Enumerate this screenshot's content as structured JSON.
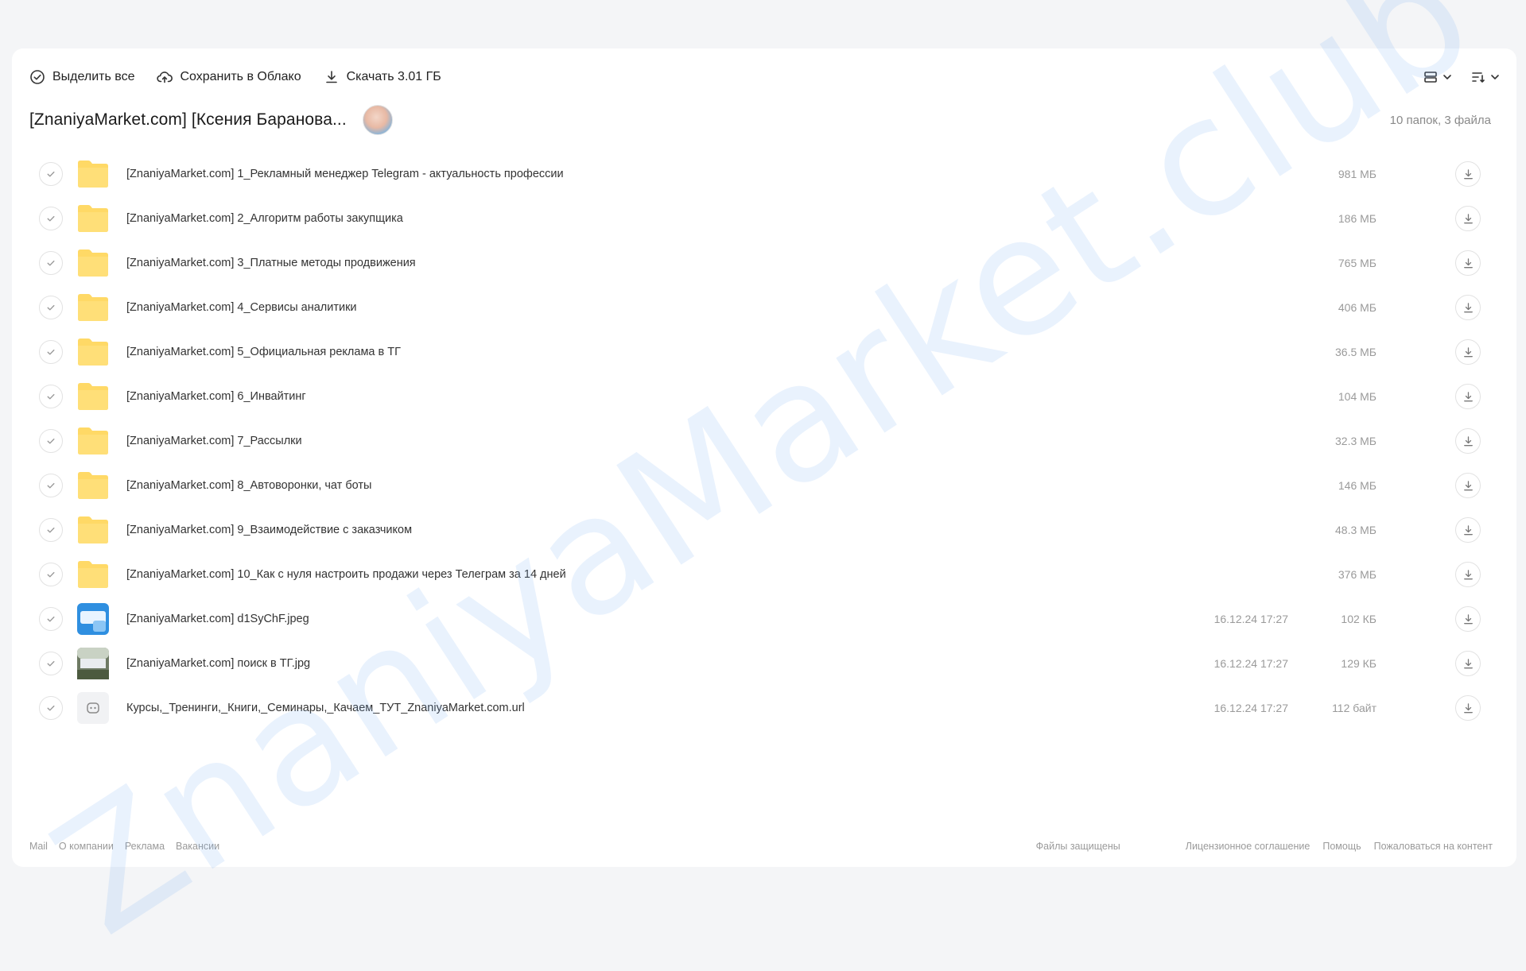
{
  "toolbar": {
    "select_all": "Выделить все",
    "save_cloud": "Сохранить в Облако",
    "download": "Скачать 3.01 ГБ",
    "view_icon": "list-view-icon",
    "sort_icon": "sort-icon"
  },
  "folder": {
    "title": "[ZnaniyaMarket.com] [Ксения Баранова...",
    "summary": "10 папок, 3 файла"
  },
  "items": [
    {
      "name": "[ZnaniyaMarket.com] 1_Рекламный менеджер Telegram - актуальность профессии",
      "date": "",
      "size": "981 МБ",
      "kind": "folder"
    },
    {
      "name": "[ZnaniyaMarket.com] 2_Алгоритм работы закупщика",
      "date": "",
      "size": "186 МБ",
      "kind": "folder"
    },
    {
      "name": "[ZnaniyaMarket.com] 3_Платные методы продвижения",
      "date": "",
      "size": "765 МБ",
      "kind": "folder"
    },
    {
      "name": "[ZnaniyaMarket.com] 4_Сервисы аналитики",
      "date": "",
      "size": "406 МБ",
      "kind": "folder"
    },
    {
      "name": "[ZnaniyaMarket.com] 5_Официальная реклама в ТГ",
      "date": "",
      "size": "36.5 МБ",
      "kind": "folder"
    },
    {
      "name": "[ZnaniyaMarket.com] 6_Инвайтинг",
      "date": "",
      "size": "104 МБ",
      "kind": "folder"
    },
    {
      "name": "[ZnaniyaMarket.com] 7_Рассылки",
      "date": "",
      "size": "32.3 МБ",
      "kind": "folder"
    },
    {
      "name": "[ZnaniyaMarket.com] 8_Автоворонки, чат боты",
      "date": "",
      "size": "146 МБ",
      "kind": "folder"
    },
    {
      "name": "[ZnaniyaMarket.com] 9_Взаимодействие с заказчиком",
      "date": "",
      "size": "48.3 МБ",
      "kind": "folder"
    },
    {
      "name": "[ZnaniyaMarket.com] 10_Как с нуля настроить продажи через Телеграм за 14 дней",
      "date": "",
      "size": "376 МБ",
      "kind": "folder"
    },
    {
      "name": "[ZnaniyaMarket.com] d1SyChF.jpeg",
      "date": "16.12.24 17:27",
      "size": "102 КБ",
      "kind": "image-blue"
    },
    {
      "name": "[ZnaniyaMarket.com] поиск в ТГ.jpg",
      "date": "16.12.24 17:27",
      "size": "129 КБ",
      "kind": "image-photo"
    },
    {
      "name": "Курсы,_Тренинги,_Книги,_Семинары,_Качаем_ТУТ_ZnaniyaMarket.com.url",
      "date": "16.12.24 17:27",
      "size": "112 байт",
      "kind": "url"
    }
  ],
  "watermark": "ZnaniyaMarket.club",
  "footer": {
    "left": [
      "Mail",
      "О компании",
      "Реклама",
      "Вакансии"
    ],
    "center": "Файлы защищены",
    "right": [
      "Лицензионное соглашение",
      "Помощь",
      "Пожаловаться на контент"
    ]
  },
  "colors": {
    "folder": "#ffd966",
    "watermark": "#78aff5",
    "background": "#f4f5f7"
  }
}
